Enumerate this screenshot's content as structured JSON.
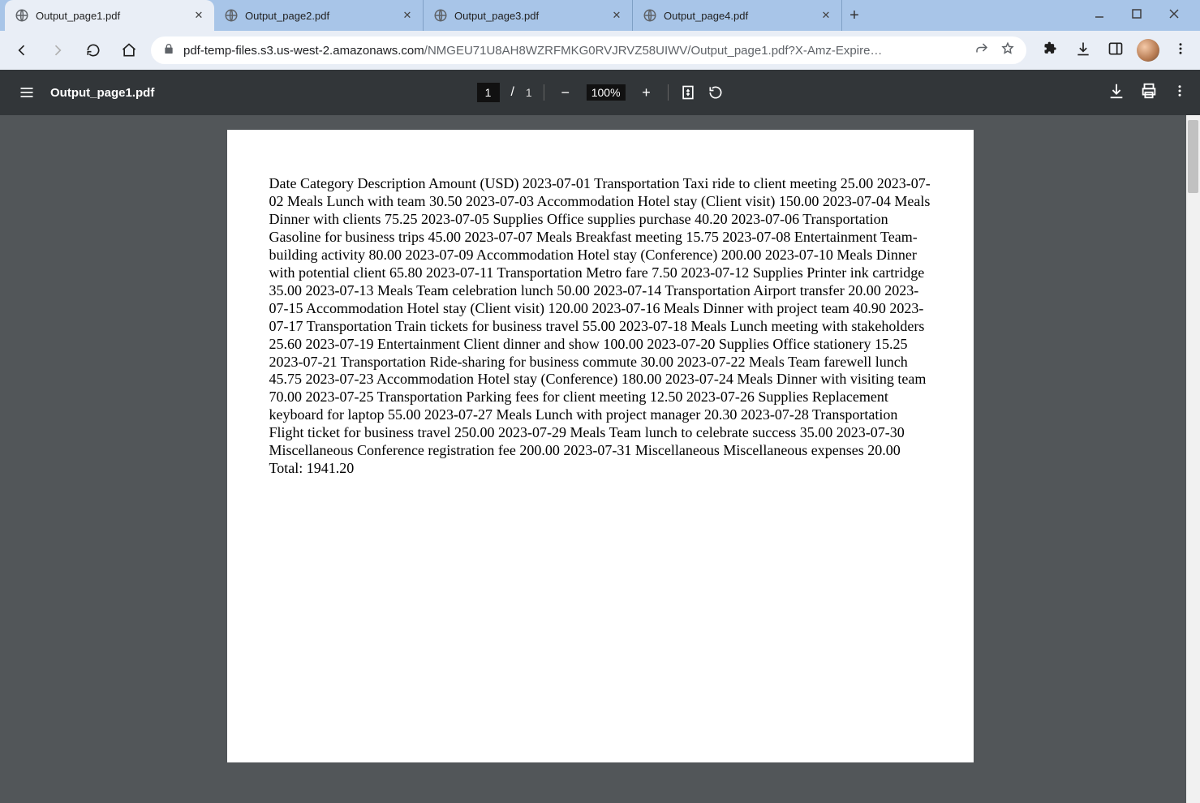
{
  "tabs": [
    {
      "label": "Output_page1.pdf",
      "active": true
    },
    {
      "label": "Output_page2.pdf",
      "active": false
    },
    {
      "label": "Output_page3.pdf",
      "active": false
    },
    {
      "label": "Output_page4.pdf",
      "active": false
    }
  ],
  "omnibox": {
    "host": "pdf-temp-files.s3.us-west-2.amazonaws.com",
    "path": "/NMGEU71U8AH8WZRFMKG0RVJRVZ58UIWV/Output_page1.pdf?X-Amz-Expire…"
  },
  "pdf_toolbar": {
    "title": "Output_page1.pdf",
    "current_page": "1",
    "page_separator": "/",
    "total_pages": "1",
    "zoom": "100%"
  },
  "document": {
    "body_text": "Date Category Description Amount (USD) 2023-07-01 Transportation Taxi ride to client meeting 25.00 2023-07-02 Meals Lunch with team 30.50 2023-07-03 Accommodation Hotel stay (Client visit) 150.00 2023-07-04 Meals Dinner with clients 75.25 2023-07-05 Supplies Office supplies purchase 40.20 2023-07-06 Transportation Gasoline for business trips 45.00 2023-07-07 Meals Breakfast meeting 15.75 2023-07-08 Entertainment Team-building activity 80.00 2023-07-09 Accommodation Hotel stay (Conference) 200.00 2023-07-10 Meals Dinner with potential client 65.80 2023-07-11 Transportation Metro fare 7.50 2023-07-12 Supplies Printer ink cartridge 35.00 2023-07-13 Meals Team celebration lunch 50.00 2023-07-14 Transportation Airport transfer 20.00 2023-07-15 Accommodation Hotel stay (Client visit) 120.00 2023-07-16 Meals Dinner with project team 40.90 2023-07-17 Transportation Train tickets for business travel 55.00 2023-07-18 Meals Lunch meeting with stakeholders 25.60 2023-07-19 Entertainment Client dinner and show 100.00 2023-07-20 Supplies Office stationery 15.25 2023-07-21 Transportation Ride-sharing for business commute 30.00 2023-07-22 Meals Team farewell lunch 45.75 2023-07-23 Accommodation Hotel stay (Conference) 180.00 2023-07-24 Meals Dinner with visiting team 70.00 2023-07-25 Transportation Parking fees for client meeting 12.50 2023-07-26 Supplies Replacement keyboard for laptop 55.00 2023-07-27 Meals Lunch with project manager 20.30 2023-07-28 Transportation Flight ticket for business travel 250.00 2023-07-29 Meals Team lunch to celebrate success 35.00 2023-07-30 Miscellaneous Conference registration fee 200.00 2023-07-31 Miscellaneous Miscellaneous expenses 20.00 Total: 1941.20"
  }
}
